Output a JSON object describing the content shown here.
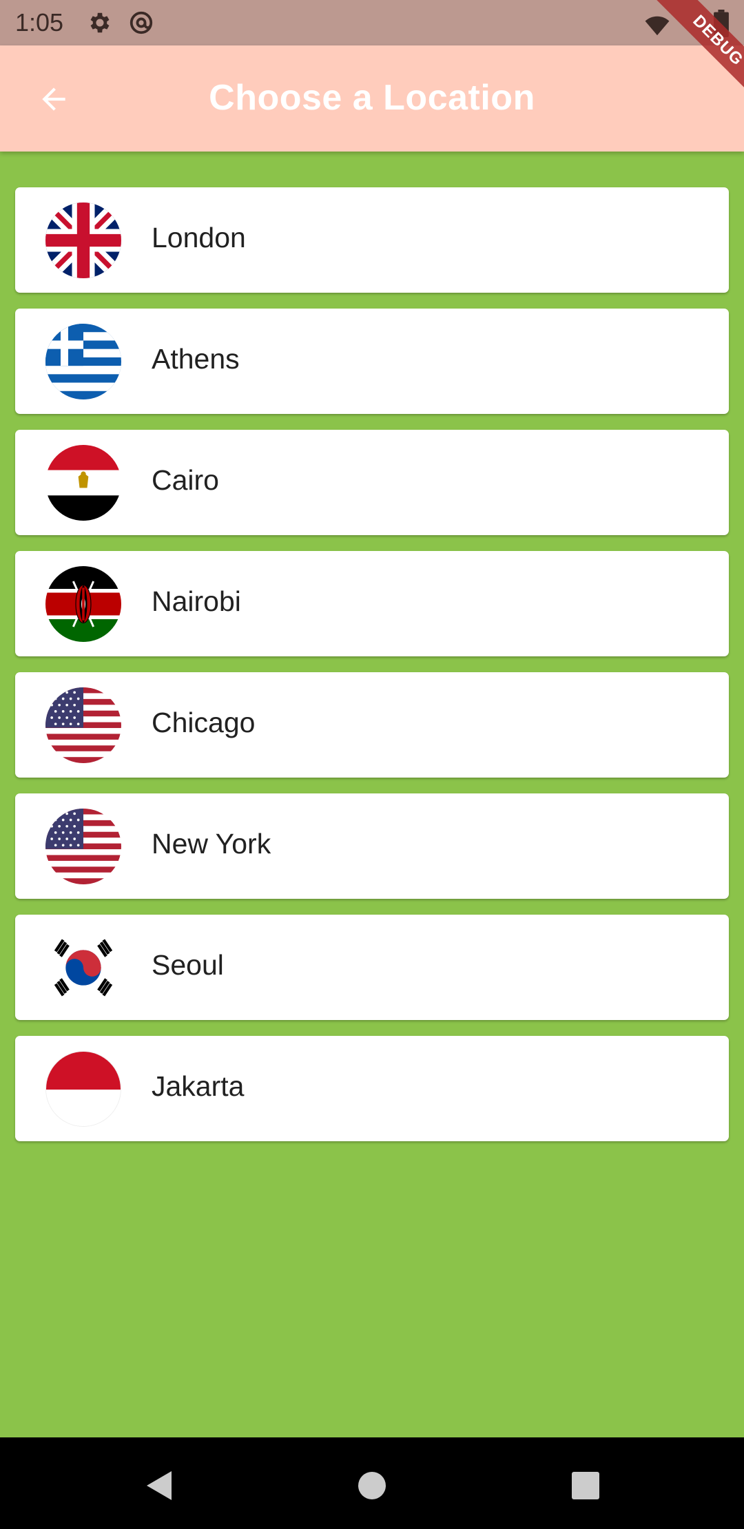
{
  "status_bar": {
    "time": "1:05",
    "icons": [
      "gear-icon",
      "at-sign-icon",
      "wifi-icon",
      "battery-icon"
    ]
  },
  "app_bar": {
    "title": "Choose a Location",
    "back_icon": "arrow-back-icon",
    "background_color": "#ffccbc",
    "title_color": "#ffffff"
  },
  "debug_banner": {
    "label": "DEBUG"
  },
  "page": {
    "background_color": "#8bc34a"
  },
  "locations": [
    {
      "city": "London",
      "flag": "united-kingdom"
    },
    {
      "city": "Athens",
      "flag": "greece"
    },
    {
      "city": "Cairo",
      "flag": "egypt"
    },
    {
      "city": "Nairobi",
      "flag": "kenya"
    },
    {
      "city": "Chicago",
      "flag": "united-states"
    },
    {
      "city": "New York",
      "flag": "united-states"
    },
    {
      "city": "Seoul",
      "flag": "south-korea"
    },
    {
      "city": "Jakarta",
      "flag": "indonesia"
    }
  ],
  "nav_bar": {
    "buttons": [
      "back-triangle-icon",
      "home-circle-icon",
      "recents-square-icon"
    ]
  }
}
